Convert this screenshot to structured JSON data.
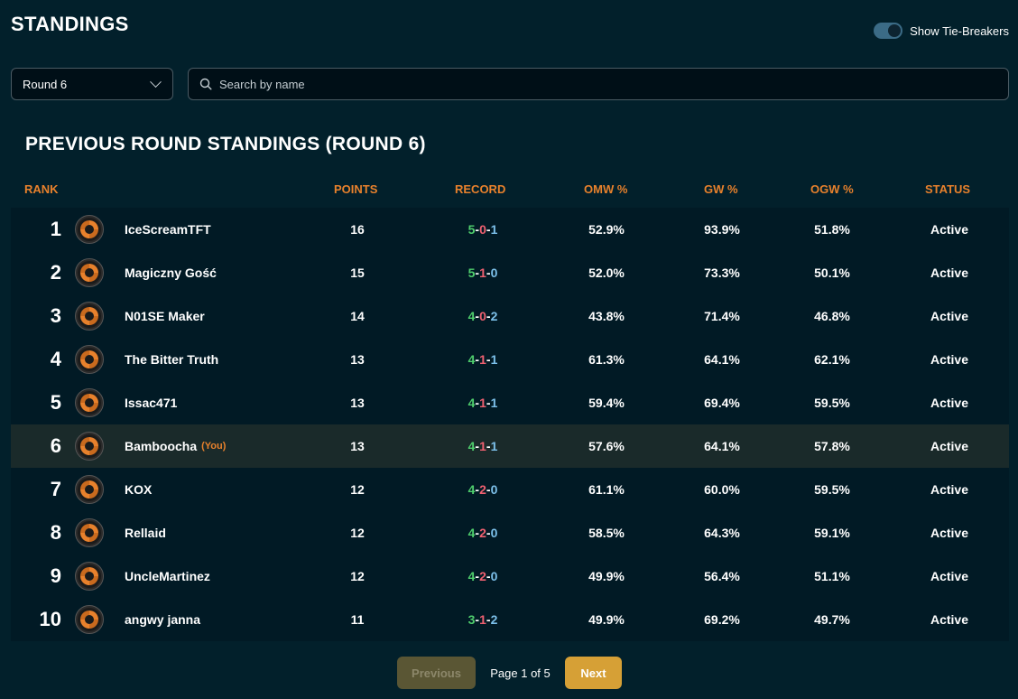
{
  "header": {
    "title": "STANDINGS",
    "tie_breaker_label": "Show Tie-Breakers",
    "tie_breaker_on": true
  },
  "filters": {
    "round_value": "Round 6",
    "search_placeholder": "Search by name"
  },
  "section_title": "PREVIOUS ROUND STANDINGS (ROUND 6)",
  "columns": {
    "rank": "RANK",
    "points": "POINTS",
    "record": "RECORD",
    "omw": "OMW %",
    "gw": "GW %",
    "ogw": "OGW %",
    "status": "STATUS"
  },
  "you_label": "(You)",
  "rows": [
    {
      "rank": "1",
      "name": "IceScreamTFT",
      "points": "16",
      "w": "5",
      "l": "0",
      "d": "1",
      "omw": "52.9%",
      "gw": "93.9%",
      "ogw": "51.8%",
      "status": "Active",
      "you": false
    },
    {
      "rank": "2",
      "name": "Magiczny Gość",
      "points": "15",
      "w": "5",
      "l": "1",
      "d": "0",
      "omw": "52.0%",
      "gw": "73.3%",
      "ogw": "50.1%",
      "status": "Active",
      "you": false
    },
    {
      "rank": "3",
      "name": "N01SE Maker",
      "points": "14",
      "w": "4",
      "l": "0",
      "d": "2",
      "omw": "43.8%",
      "gw": "71.4%",
      "ogw": "46.8%",
      "status": "Active",
      "you": false
    },
    {
      "rank": "4",
      "name": "The Bitter Truth",
      "points": "13",
      "w": "4",
      "l": "1",
      "d": "1",
      "omw": "61.3%",
      "gw": "64.1%",
      "ogw": "62.1%",
      "status": "Active",
      "you": false
    },
    {
      "rank": "5",
      "name": "Issac471",
      "points": "13",
      "w": "4",
      "l": "1",
      "d": "1",
      "omw": "59.4%",
      "gw": "69.4%",
      "ogw": "59.5%",
      "status": "Active",
      "you": false
    },
    {
      "rank": "6",
      "name": "Bamboocha",
      "points": "13",
      "w": "4",
      "l": "1",
      "d": "1",
      "omw": "57.6%",
      "gw": "64.1%",
      "ogw": "57.8%",
      "status": "Active",
      "you": true
    },
    {
      "rank": "7",
      "name": "KOX",
      "points": "12",
      "w": "4",
      "l": "2",
      "d": "0",
      "omw": "61.1%",
      "gw": "60.0%",
      "ogw": "59.5%",
      "status": "Active",
      "you": false
    },
    {
      "rank": "8",
      "name": "Rellaid",
      "points": "12",
      "w": "4",
      "l": "2",
      "d": "0",
      "omw": "58.5%",
      "gw": "64.3%",
      "ogw": "59.1%",
      "status": "Active",
      "you": false
    },
    {
      "rank": "9",
      "name": "UncleMartinez",
      "points": "12",
      "w": "4",
      "l": "2",
      "d": "0",
      "omw": "49.9%",
      "gw": "56.4%",
      "ogw": "51.1%",
      "status": "Active",
      "you": false
    },
    {
      "rank": "10",
      "name": "angwy janna",
      "points": "11",
      "w": "3",
      "l": "1",
      "d": "2",
      "omw": "49.9%",
      "gw": "69.2%",
      "ogw": "49.7%",
      "status": "Active",
      "you": false
    }
  ],
  "pagination": {
    "prev_label": "Previous",
    "page_info": "Page 1 of 5",
    "next_label": "Next",
    "prev_disabled": true
  },
  "colors": {
    "accent": "#e8812c",
    "win": "#4fce6d",
    "loss": "#ee6070",
    "draw": "#7cc0ea",
    "next_button": "#d6a036",
    "background": "#02202b"
  },
  "icons": {
    "player_avatar": "orange-swirl-logo-icon",
    "search": "search-icon",
    "dropdown": "chevron-down-icon"
  }
}
